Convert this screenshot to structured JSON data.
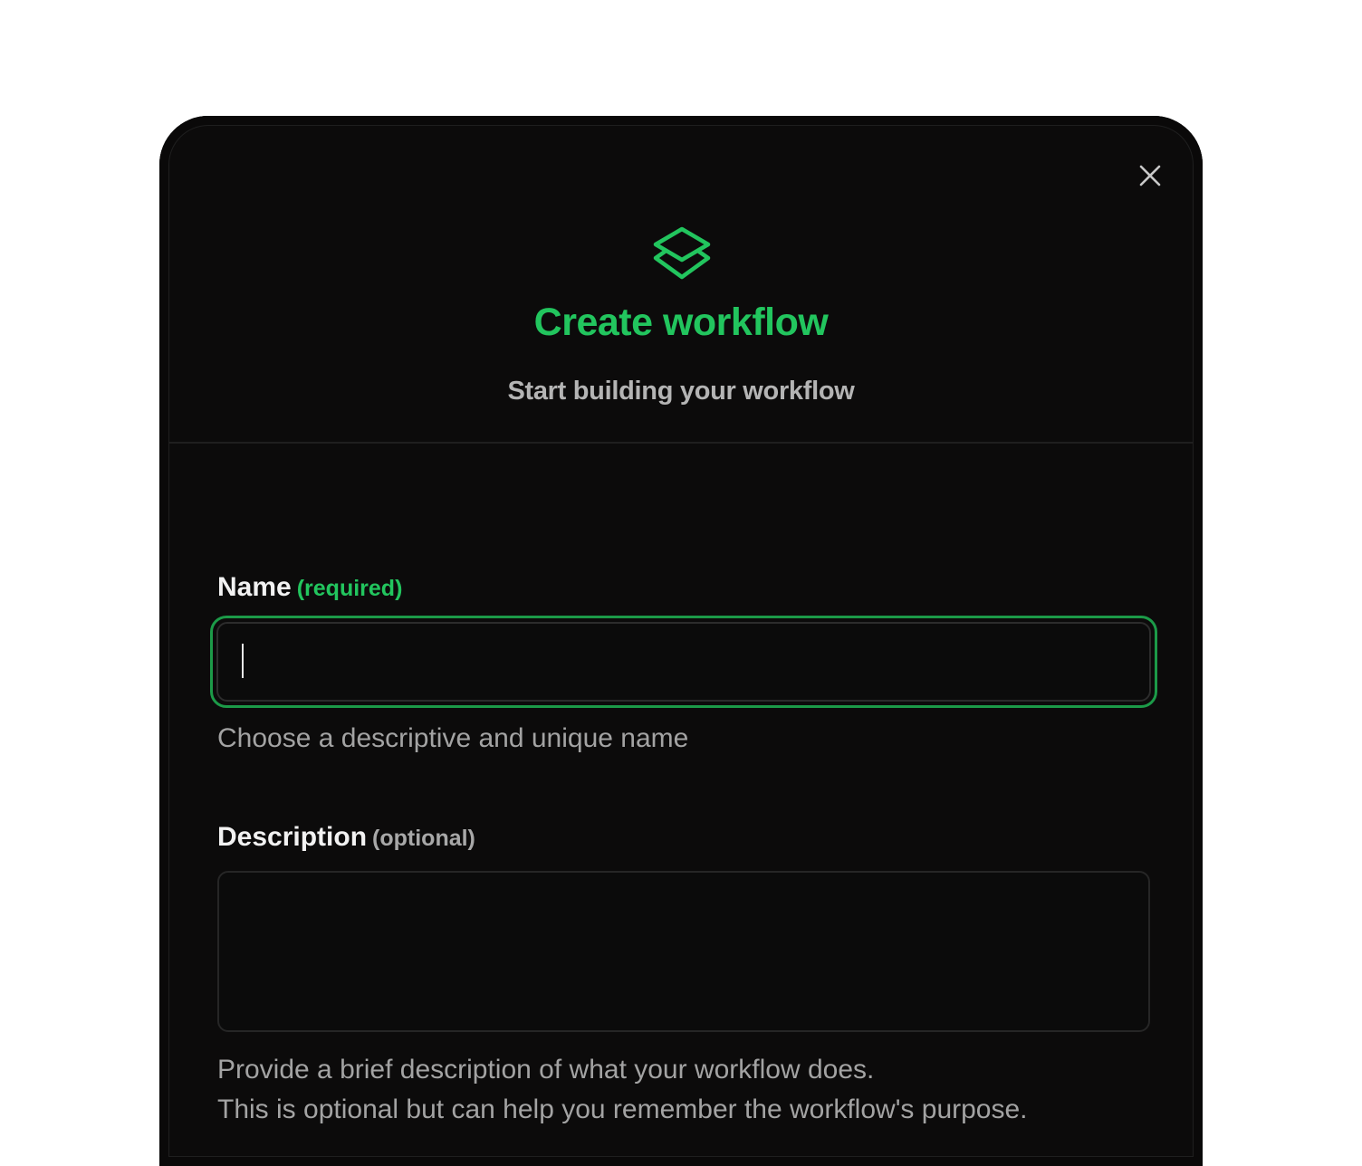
{
  "dialog": {
    "title": "Create workflow",
    "subtitle": "Start building your workflow",
    "header_icon": "layers-icon",
    "close_icon": "close-icon",
    "accent_color": "#22c55e"
  },
  "form": {
    "name": {
      "label": "Name",
      "tag": "(required)",
      "value": "",
      "helper": "Choose a descriptive and unique name"
    },
    "description": {
      "label": "Description",
      "tag": "(optional)",
      "value": "",
      "helper_line1": "Provide a brief description of what your workflow does.",
      "helper_line2": "This is optional but can help you remember the workflow's purpose."
    }
  }
}
